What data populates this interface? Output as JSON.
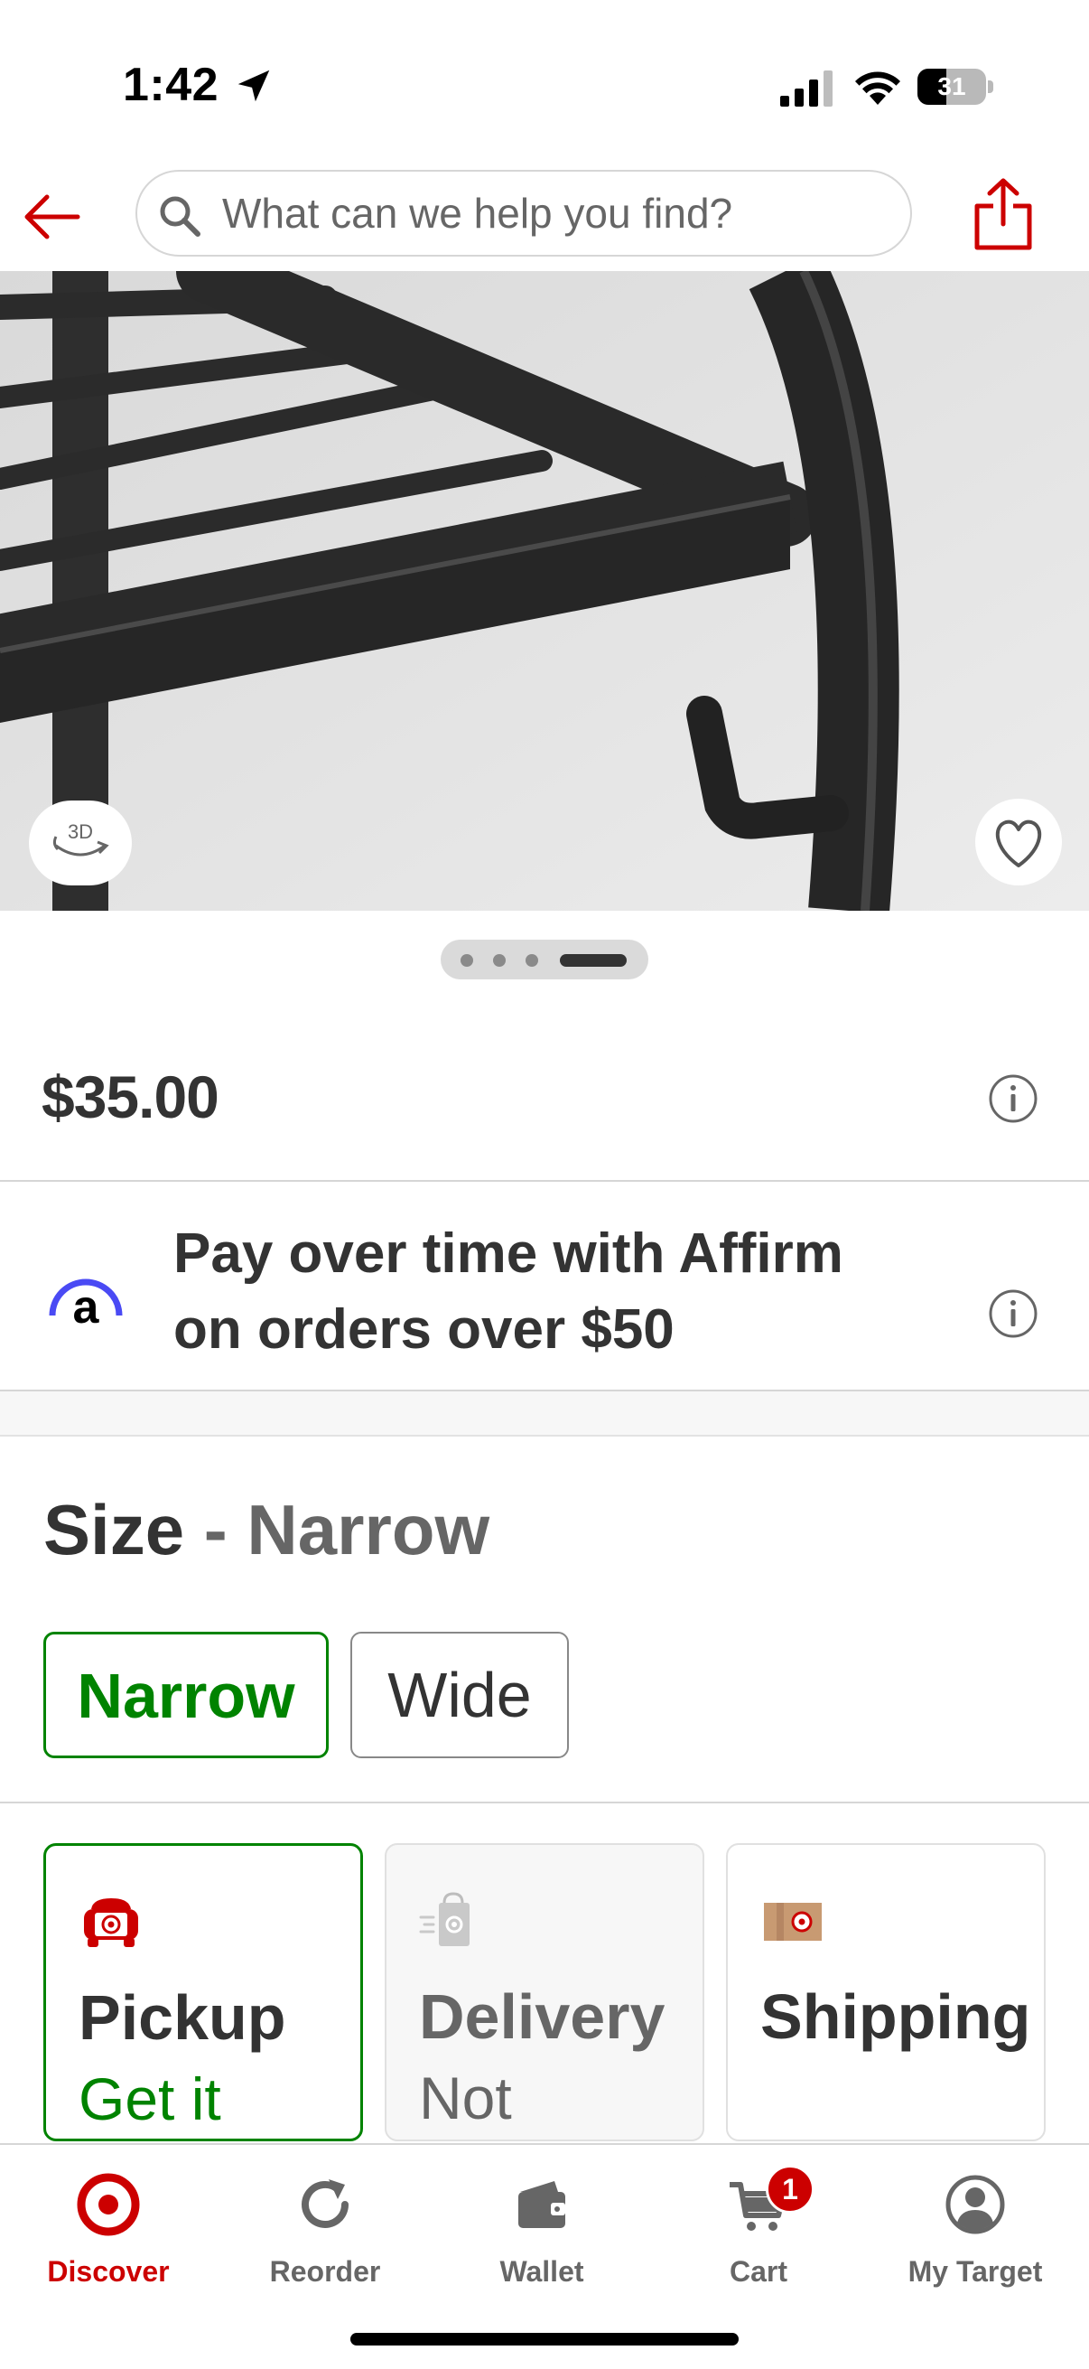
{
  "status_bar": {
    "time": "1:42",
    "battery": "31"
  },
  "search": {
    "placeholder": "What can we help you find?"
  },
  "product": {
    "price": "$35.00",
    "image_dots_total": 4,
    "image_dot_active": 4
  },
  "affirm": {
    "line1": "Pay over time with Affirm",
    "line2": "on orders over $50",
    "logo_letter": "a"
  },
  "size": {
    "label": "Size",
    "separator": "-",
    "selected": "Narrow",
    "options": [
      "Narrow",
      "Wide"
    ]
  },
  "fulfillment": [
    {
      "title": "Pickup",
      "subtitle": "Get it",
      "subtitle_color": "#008300",
      "icon": "pickup-drive-icon"
    },
    {
      "title": "Delivery",
      "subtitle": "Not",
      "subtitle_color": "#666666",
      "icon": "delivery-bag-icon"
    },
    {
      "title": "Shipping",
      "subtitle": "",
      "subtitle_color": "#333333",
      "icon": "shipping-box-icon"
    }
  ],
  "tabs": [
    {
      "label": "Discover",
      "icon": "target-bullseye-icon",
      "active": true
    },
    {
      "label": "Reorder",
      "icon": "reorder-refresh-icon",
      "active": false
    },
    {
      "label": "Wallet",
      "icon": "wallet-icon",
      "active": false
    },
    {
      "label": "Cart",
      "icon": "cart-icon",
      "active": false,
      "badge": "1"
    },
    {
      "label": "My Target",
      "icon": "account-icon",
      "active": false
    }
  ],
  "colors": {
    "brand_red": "#cc0000",
    "selected_green": "#008300",
    "text": "#333333"
  }
}
